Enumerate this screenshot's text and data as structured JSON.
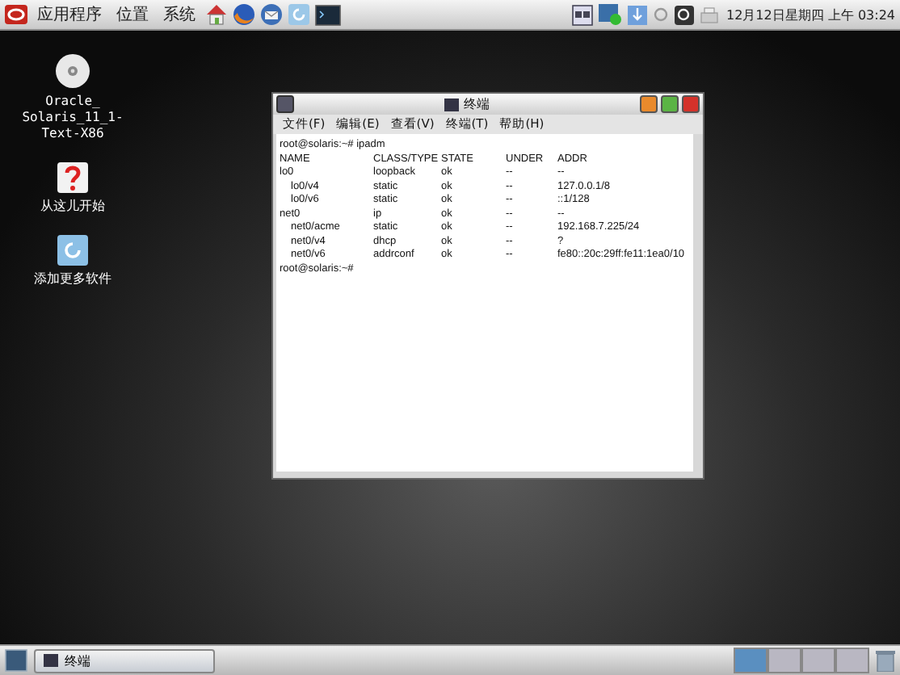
{
  "top_panel": {
    "menus": [
      "应用程序",
      "位置",
      "系统"
    ],
    "clock": "12月12日星期四 上午 03:24"
  },
  "desktop_icons": [
    {
      "kind": "disc",
      "label_lines": [
        "Oracle_",
        "Solaris_11_1-",
        "Text-X86"
      ]
    },
    {
      "kind": "help",
      "label_lines": [
        "从这儿开始"
      ]
    },
    {
      "kind": "update",
      "label_lines": [
        "添加更多软件"
      ]
    }
  ],
  "terminal": {
    "title": "终端",
    "menus": [
      "文件(F)",
      "编辑(E)",
      "查看(V)",
      "终端(T)",
      "帮助(H)"
    ],
    "lines": [
      {
        "kind": "prompt",
        "text": "root@solaris:~# ipadm"
      },
      {
        "kind": "row",
        "indent": false,
        "cells": [
          "NAME",
          "CLASS/TYPE",
          "STATE",
          "UNDER",
          "ADDR"
        ]
      },
      {
        "kind": "row",
        "indent": false,
        "cells": [
          "lo0",
          "loopback",
          "ok",
          "--",
          "--"
        ]
      },
      {
        "kind": "row",
        "indent": true,
        "cells": [
          "lo0/v4",
          "static",
          "ok",
          "--",
          "127.0.0.1/8"
        ]
      },
      {
        "kind": "row",
        "indent": true,
        "cells": [
          "lo0/v6",
          "static",
          "ok",
          "--",
          "::1/128"
        ]
      },
      {
        "kind": "row",
        "indent": false,
        "cells": [
          "net0",
          "ip",
          "ok",
          "--",
          "--"
        ]
      },
      {
        "kind": "row",
        "indent": true,
        "cells": [
          "net0/acme",
          "static",
          "ok",
          "--",
          "192.168.7.225/24"
        ]
      },
      {
        "kind": "row",
        "indent": true,
        "cells": [
          "net0/v4",
          "dhcp",
          "ok",
          "--",
          "?"
        ]
      },
      {
        "kind": "row",
        "indent": true,
        "cells": [
          "net0/v6",
          "addrconf",
          "ok",
          "--",
          "fe80::20c:29ff:fe11:1ea0/10"
        ]
      },
      {
        "kind": "prompt",
        "text": "root@solaris:~#"
      }
    ]
  },
  "taskbar": {
    "windows": [
      {
        "label": "终端",
        "selected": false
      }
    ],
    "workspaces": [
      {
        "selected": true
      },
      {
        "selected": false
      },
      {
        "selected": false
      },
      {
        "selected": false
      }
    ]
  }
}
